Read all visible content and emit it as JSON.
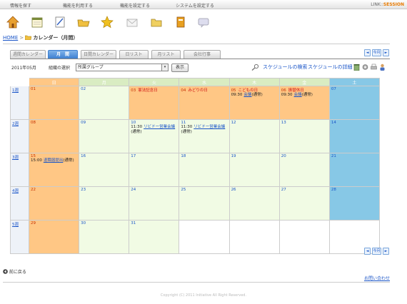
{
  "topmenu": [
    "情報を探す",
    "機能を利用する",
    "機能を設定する",
    "システムを設定する"
  ],
  "logo": {
    "prefix": "LINK::",
    "brand": "SESSION"
  },
  "breadcrumb": {
    "home": "HOME",
    "separator": ">",
    "current": "カレンダー（月間）"
  },
  "tabs": [
    "週間カレンダー",
    "月　間",
    "日間カレンダー",
    "日リスト",
    "月リスト",
    "会社行事"
  ],
  "nav": {
    "prev": "◄",
    "today": "今月",
    "next": "►"
  },
  "controls": {
    "month_label": "2011年05月",
    "group_label": "組織の選択",
    "group_value": "所属グループ",
    "show_button": "表示",
    "search_link": "スケジュールの検索",
    "detail_link": "スケジュールの詳細"
  },
  "calendar": {
    "days": [
      "日",
      "月",
      "火",
      "水",
      "木",
      "金",
      "土"
    ],
    "weeks": [
      {
        "label": "1週",
        "cells": [
          {
            "day": "01",
            "type": "sun"
          },
          {
            "day": "02",
            "type": "wd"
          },
          {
            "day": "03",
            "type": "hol",
            "holiday": "憲法記念日"
          },
          {
            "day": "04",
            "type": "hol",
            "holiday": "みどりの日"
          },
          {
            "day": "05",
            "type": "hol",
            "holiday": "こどもの日",
            "events": [
              {
                "time": "09:30",
                "link": "会議",
                "note": "(通常)"
              }
            ]
          },
          {
            "day": "06",
            "type": "hol",
            "holiday": "振替休日",
            "events": [
              {
                "time": "09:30",
                "link": "会議",
                "note": "(通常)"
              }
            ]
          },
          {
            "day": "07",
            "type": "sat"
          }
        ]
      },
      {
        "label": "2週",
        "cells": [
          {
            "day": "08",
            "type": "sun"
          },
          {
            "day": "09",
            "type": "wd"
          },
          {
            "day": "10",
            "type": "wd",
            "events": [
              {
                "time": "11:30",
                "link": "リビドー営業会議",
                "note": "(通常)"
              }
            ]
          },
          {
            "day": "11",
            "type": "wd",
            "events": [
              {
                "time": "11:30",
                "link": "リビドー営業会議",
                "note": "(通常)"
              }
            ]
          },
          {
            "day": "12",
            "type": "wd"
          },
          {
            "day": "13",
            "type": "wd"
          },
          {
            "day": "14",
            "type": "sat"
          }
        ]
      },
      {
        "label": "3週",
        "cells": [
          {
            "day": "15",
            "type": "sun",
            "events": [
              {
                "time": "15:00",
                "link": "退職届提出",
                "note": "(通常)"
              }
            ]
          },
          {
            "day": "16",
            "type": "wd"
          },
          {
            "day": "17",
            "type": "wd"
          },
          {
            "day": "18",
            "type": "wd"
          },
          {
            "day": "19",
            "type": "wd"
          },
          {
            "day": "20",
            "type": "wd"
          },
          {
            "day": "21",
            "type": "sat"
          }
        ]
      },
      {
        "label": "4週",
        "cells": [
          {
            "day": "22",
            "type": "sun"
          },
          {
            "day": "23",
            "type": "wd"
          },
          {
            "day": "24",
            "type": "wd"
          },
          {
            "day": "25",
            "type": "wd"
          },
          {
            "day": "26",
            "type": "wd"
          },
          {
            "day": "27",
            "type": "wd"
          },
          {
            "day": "28",
            "type": "sat"
          }
        ]
      },
      {
        "label": "5週",
        "cells": [
          {
            "day": "29",
            "type": "sun"
          },
          {
            "day": "30",
            "type": "wd"
          },
          {
            "day": "31",
            "type": "wd"
          },
          {
            "day": "",
            "type": "blank"
          },
          {
            "day": "",
            "type": "blank"
          },
          {
            "day": "",
            "type": "blank"
          },
          {
            "day": "",
            "type": "blank"
          }
        ]
      }
    ]
  },
  "footer": {
    "back": "前に戻る",
    "inquiry": "お問い合わせ",
    "copyright": "Copyright (C) 2011 Initiative All Right Reserved."
  },
  "colors": {
    "sunday": "#ffc785",
    "saturday": "#87c8e6",
    "weekday": "#f1fbe4",
    "accent": "#3d7fd0"
  },
  "icons": [
    "home-icon",
    "calendar-icon",
    "memo-icon",
    "folder-icon",
    "star-icon",
    "mail-icon",
    "document-icon",
    "book-icon",
    "chat-icon"
  ]
}
